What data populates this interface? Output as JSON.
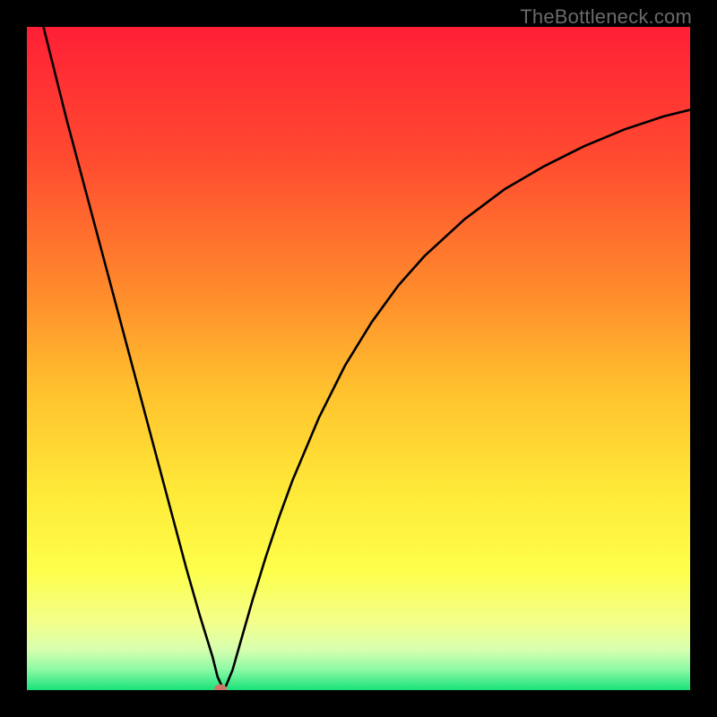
{
  "watermark": "TheBottleneck.com",
  "chart_data": {
    "type": "line",
    "title": "",
    "xlabel": "",
    "ylabel": "",
    "xlim": [
      0,
      100
    ],
    "ylim": [
      0,
      100
    ],
    "grid": false,
    "legend": false,
    "background_gradient": {
      "stops": [
        {
          "offset": 0.0,
          "color": "#ff1f36"
        },
        {
          "offset": 0.2,
          "color": "#ff4b30"
        },
        {
          "offset": 0.4,
          "color": "#ff8b2c"
        },
        {
          "offset": 0.55,
          "color": "#ffc22e"
        },
        {
          "offset": 0.7,
          "color": "#ffe938"
        },
        {
          "offset": 0.82,
          "color": "#fdff4a"
        },
        {
          "offset": 0.9,
          "color": "#f3ff8e"
        },
        {
          "offset": 0.94,
          "color": "#d6ffb0"
        },
        {
          "offset": 0.97,
          "color": "#89f9a3"
        },
        {
          "offset": 1.0,
          "color": "#18e27a"
        }
      ]
    },
    "series": [
      {
        "name": "bottleneck-curve",
        "color": "#000000",
        "x": [
          0,
          2,
          4,
          6,
          8,
          10,
          12,
          14,
          16,
          18,
          20,
          22,
          24,
          26,
          28,
          28.75,
          29.5,
          30,
          31,
          32,
          34,
          36,
          38,
          40,
          44,
          48,
          52,
          56,
          60,
          66,
          72,
          78,
          84,
          90,
          96,
          100
        ],
        "y": [
          110.0,
          102.0,
          94.0,
          86.0,
          78.5,
          71.0,
          63.5,
          56.0,
          48.5,
          41.0,
          33.5,
          26.0,
          18.5,
          11.5,
          5.0,
          2.0,
          0.4,
          0.6,
          3.0,
          6.5,
          13.5,
          20.0,
          26.0,
          31.5,
          41.0,
          49.0,
          55.5,
          61.0,
          65.5,
          71.0,
          75.5,
          79.0,
          82.0,
          84.5,
          86.5,
          87.5
        ]
      }
    ],
    "marker": {
      "name": "optimal-point",
      "x": 29.2,
      "y": 0.2,
      "color": "#cc7766",
      "rx": 7,
      "ry": 5
    }
  }
}
